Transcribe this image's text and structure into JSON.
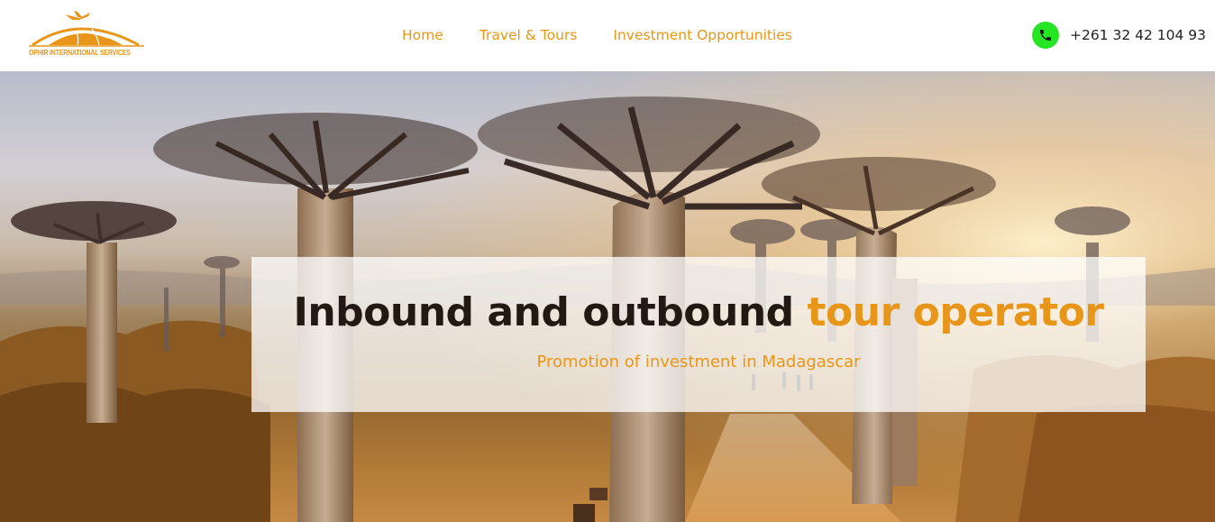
{
  "brand": {
    "logo_text": "OPHIR INTERNATIONAL SERVICES",
    "accent_color": "#e8961a"
  },
  "nav": {
    "items": [
      {
        "label": "Home"
      },
      {
        "label": "Travel & Tours"
      },
      {
        "label": "Investment Opportunities"
      }
    ]
  },
  "contact": {
    "phone_icon": "phone-icon",
    "icon_color": "#25e525",
    "phone": "+261 32 42 104 93"
  },
  "hero": {
    "title_main": "Inbound and outbound ",
    "title_accent": "tour operator",
    "subtitle": "Promotion of investment in Madagascar",
    "background_image": "baobab-avenue-photo"
  }
}
